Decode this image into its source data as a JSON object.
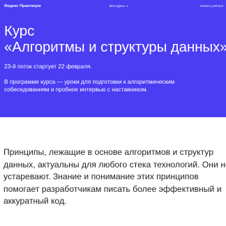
{
  "header": {
    "logo": "Яндекс Практикум",
    "courses_menu": "Все курсы",
    "start_link": "Начать учиться"
  },
  "hero": {
    "title_line1": "Курс",
    "title_line2": "«Алгоритмы и структуры данных»",
    "subtitle": "23-й поток стартует 22 февраля.",
    "description": "В программе курса — уроки для подготовки к алгоритмическим собеседованиям и пробное интервью с наставником."
  },
  "content": {
    "paragraph": "Принципы, лежащие в основе алгоритмов и структур данных, актуальны для любого стека технологий. Они не устаревают. Знание и понимание этих принципов помогает разработчикам писать более эффективный и аккуратный код."
  },
  "colors": {
    "hero_background": "#4a3df2",
    "hero_text": "#ffffff",
    "body_text": "#1f1f1f"
  },
  "icons": {
    "courses_menu": "chevron-down-icon"
  }
}
